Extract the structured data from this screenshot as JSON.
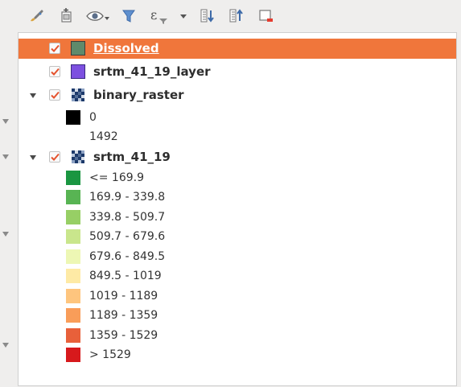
{
  "toolbar": {
    "icons": [
      "paint-brush-icon",
      "add-group-icon",
      "visibility-eye-icon",
      "filter-icon",
      "expression-filter-icon",
      "expand-all-icon",
      "collapse-all-icon",
      "remove-layer-icon"
    ]
  },
  "layers": [
    {
      "label": "Dissolved",
      "checked": true,
      "selected": true,
      "swatch_color": "#5f8a6b"
    },
    {
      "label": "srtm_41_19_layer",
      "checked": true,
      "swatch_color": "#7d50e0"
    },
    {
      "label": "binary_raster",
      "checked": true,
      "expanded": true,
      "legend": [
        {
          "label": "0",
          "color": "#000000"
        },
        {
          "label": "1492",
          "color": "#ffffff"
        }
      ]
    },
    {
      "label": "srtm_41_19",
      "checked": true,
      "expanded": true,
      "legend": [
        {
          "label": "<= 169.9",
          "color": "#1a9641"
        },
        {
          "label": "169.9 - 339.8",
          "color": "#58b453"
        },
        {
          "label": "339.8 - 509.7",
          "color": "#97cf65"
        },
        {
          "label": "509.7 - 679.6",
          "color": "#c9e68c"
        },
        {
          "label": "679.6 - 849.5",
          "color": "#edf7b4"
        },
        {
          "label": "849.5 - 1019",
          "color": "#feeaa5"
        },
        {
          "label": "1019 - 1189",
          "color": "#fec57e"
        },
        {
          "label": "1189 - 1359",
          "color": "#f99d59"
        },
        {
          "label": "1359 - 1529",
          "color": "#e8603a"
        },
        {
          "label": "> 1529",
          "color": "#d7191c"
        }
      ]
    }
  ],
  "colors": {
    "selection": "#f0763b",
    "checkbox_check": "#e5532e"
  }
}
